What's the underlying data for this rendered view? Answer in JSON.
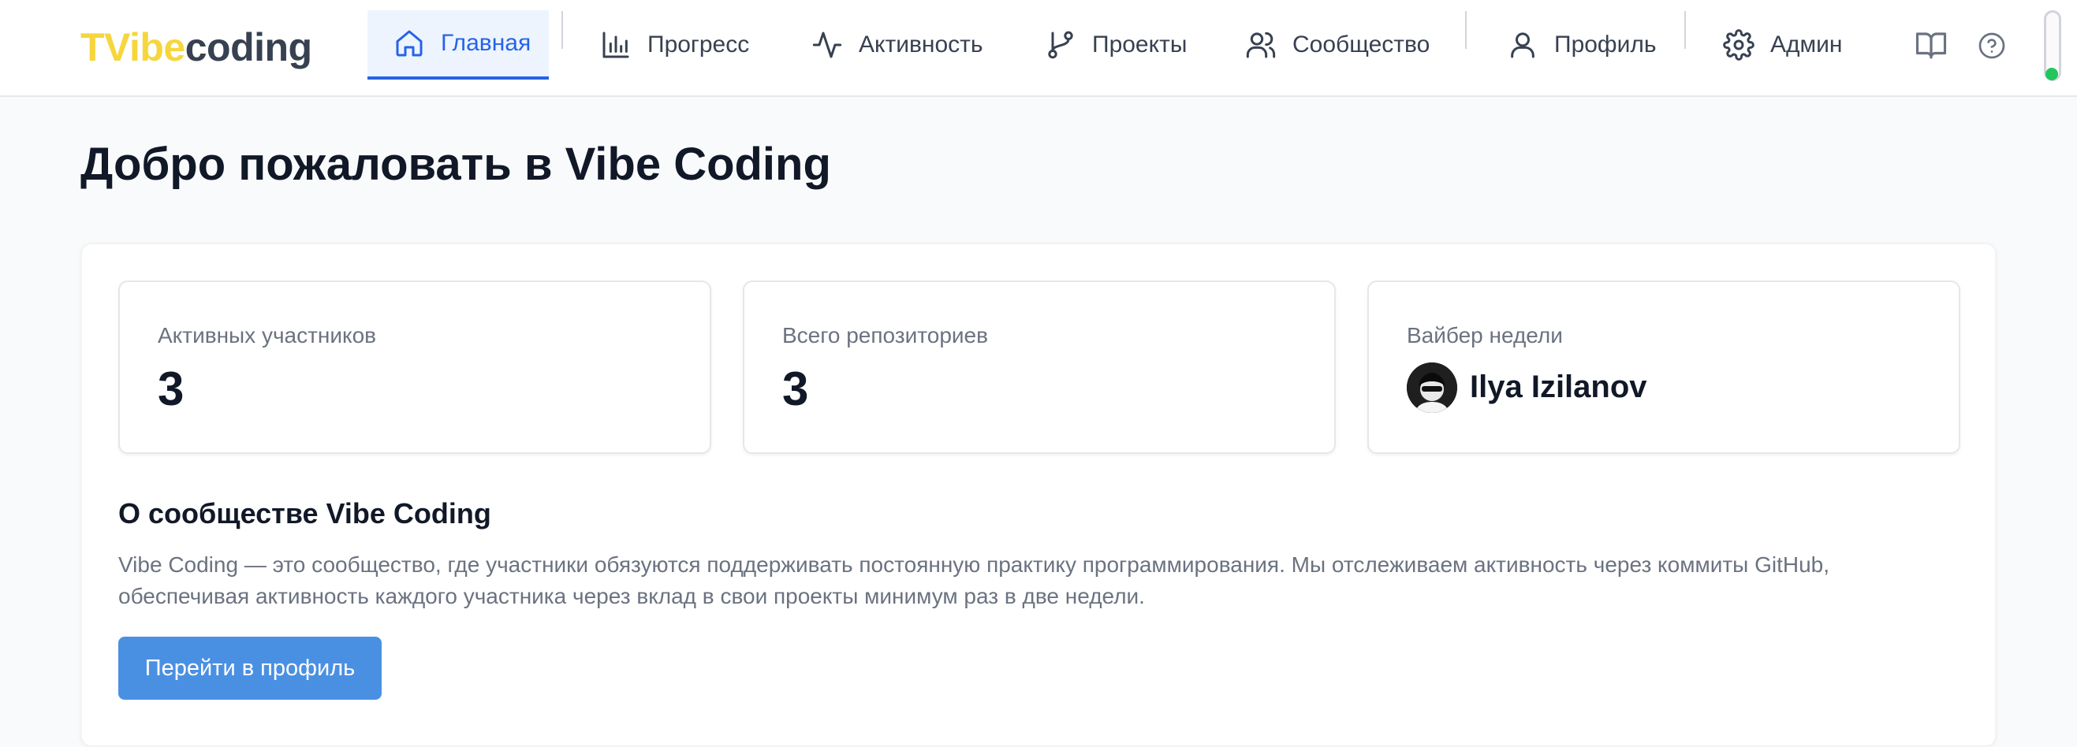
{
  "logo": {
    "part1": "TVibe",
    "part2": "coding"
  },
  "nav": {
    "home": "Главная",
    "progress": "Прогресс",
    "activity": "Активность",
    "projects": "Проекты",
    "community": "Сообщество",
    "profile": "Профиль",
    "admin": "Админ"
  },
  "utility_icons": [
    "book-icon",
    "help-circle-icon"
  ],
  "page": {
    "title": "Добро пожаловать в Vibe Coding"
  },
  "stats": {
    "active_members": {
      "label": "Активных участников",
      "value": "3"
    },
    "total_repos": {
      "label": "Всего репозиториев",
      "value": "3"
    },
    "viber_of_week": {
      "label": "Вайбер недели",
      "name": "Ilya Izilanov"
    }
  },
  "about": {
    "title": "О сообществе Vibe Coding",
    "text": "Vibe Coding — это сообщество, где участники обязуются поддерживать постоянную практику программирования. Мы отслеживаем активность через коммиты GitHub, обеспечивая активность каждого участника через вклад в свои проекты минимум раз в две недели.",
    "button": "Перейти в профиль"
  },
  "colors": {
    "accent": "#2563eb",
    "logo_yellow": "#f6d63e",
    "button": "#4a90e2",
    "status_green": "#22c55e"
  }
}
